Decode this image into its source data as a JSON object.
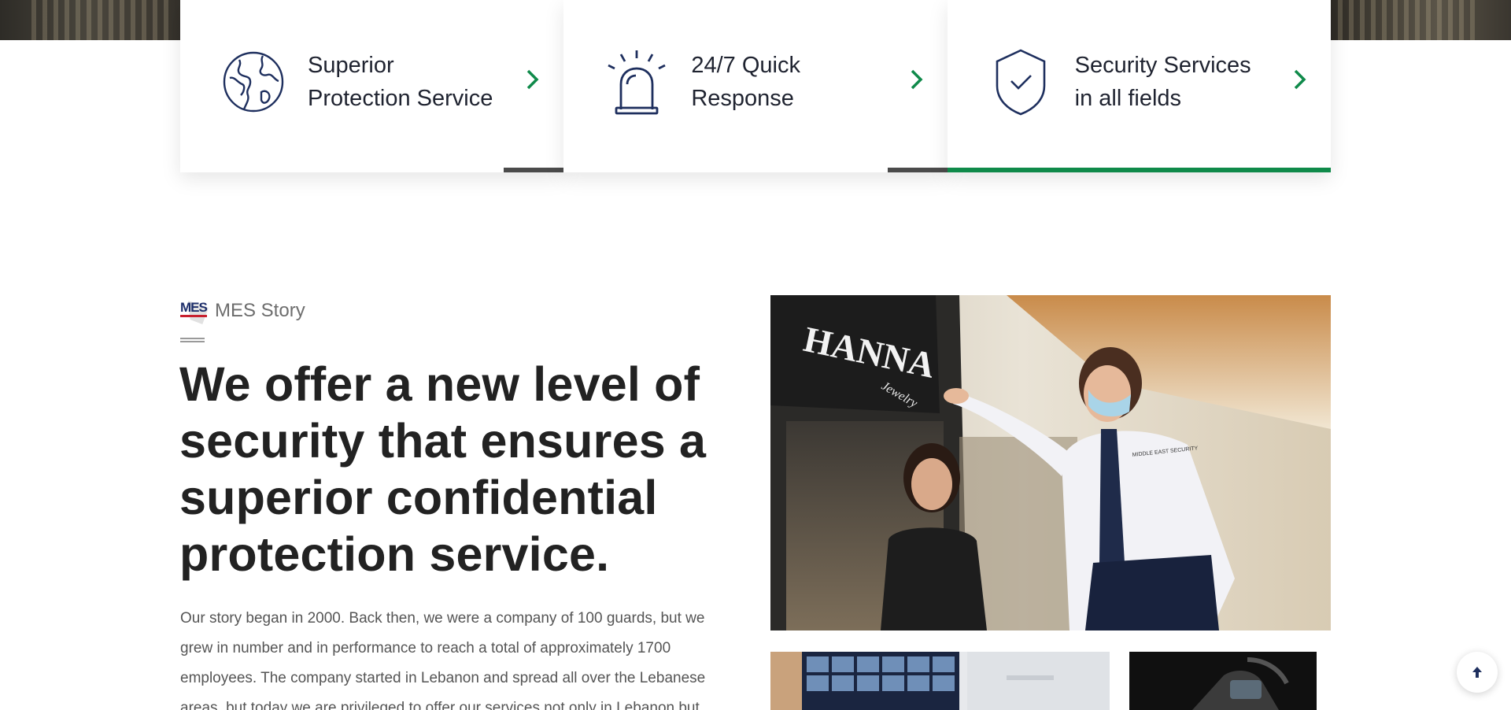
{
  "features": [
    {
      "title_line1": "Superior",
      "title_line2": "Protection Service",
      "icon": "globe-icon"
    },
    {
      "title_line1": "24/7 Quick",
      "title_line2": "Response",
      "icon": "alarm-siren-icon"
    },
    {
      "title_line1": "Security Services",
      "title_line2": "in all fields",
      "icon": "shield-check-icon"
    }
  ],
  "story": {
    "logo_text": "MES",
    "label": "MES Story",
    "headline": "We offer a new level of security that ensures a superior confidential protection service.",
    "body": "Our story began in 2000. Back then, we were a company of 100 guards, but we grew in number and in performance to reach a total of approximately 1700 employees. The company started in Lebanon and spread all over the Lebanese areas, but today we are privileged to offer our services not only in Lebanon but"
  },
  "photos": {
    "main_store_sign": "HANNA",
    "main_store_sub": "Jewelry",
    "badge_text": "MIDDLE EAST SECURITY"
  },
  "colors": {
    "accent_green": "#0f8a4a",
    "icon_navy": "#1e2f5e",
    "inactive_bar": "#4b4b4b",
    "heading": "#222222",
    "body": "#555555"
  },
  "scroll_top": {
    "icon": "arrow-up-icon"
  }
}
